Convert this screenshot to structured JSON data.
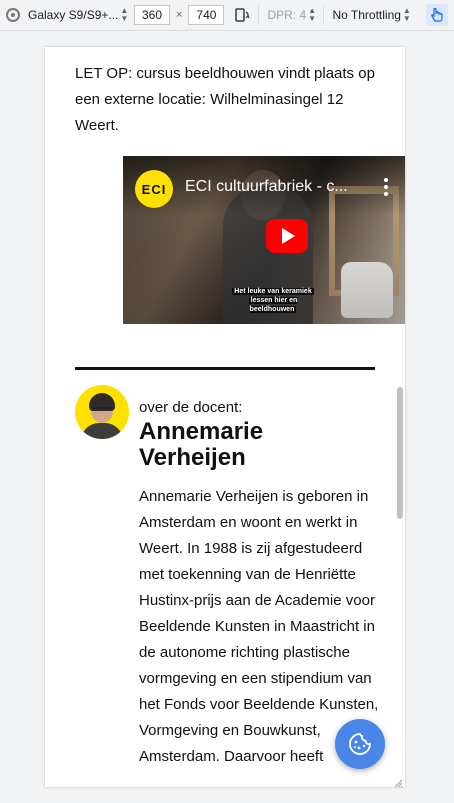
{
  "toolbar": {
    "device": "Galaxy S9/S9+...",
    "width_value": "360",
    "times": "×",
    "height_value": "740",
    "dpr": "DPR: 4",
    "throttling": "No Throttling"
  },
  "page": {
    "intro_text": "LET OP: cursus beeldhouwen vindt plaats op een externe locatie: Wilhelminasingel 12 Weert.",
    "video": {
      "logo_text": "ECI",
      "title": "ECI cultuurfabriek - c...",
      "caption_line1": "Het leuke van keramiek",
      "caption_line2": "lessen hier en beeldhouwen"
    },
    "teacher": {
      "label": "over de docent:",
      "name": "Annemarie Verheijen",
      "bio": "Annemarie Verheijen is geboren in Amsterdam en woont en werkt in Weert. In 1988 is zij afgestudeerd met toekenning van de Henriëtte Hustinx-prijs aan de Academie voor Beeldende Kunsten in Maastricht in de autonome richting plastische vormgeving en een stipendium van het Fonds voor Beeldende Kunsten, Vormgeving en Bouwkunst, Amsterdam. Daarvoor heeft"
    }
  },
  "colors": {
    "accent_yellow": "#ffe100",
    "cookie_button": "#4a86e8",
    "youtube_red": "#ff0000",
    "touch_highlight": "#1a73e8"
  },
  "icons": {
    "browser": "chrome-icon",
    "rotate": "rotate-icon",
    "touch": "touch-hand-icon",
    "cookie": "cookie-icon",
    "play": "youtube-play-icon",
    "menu": "more-vertical-icon"
  }
}
